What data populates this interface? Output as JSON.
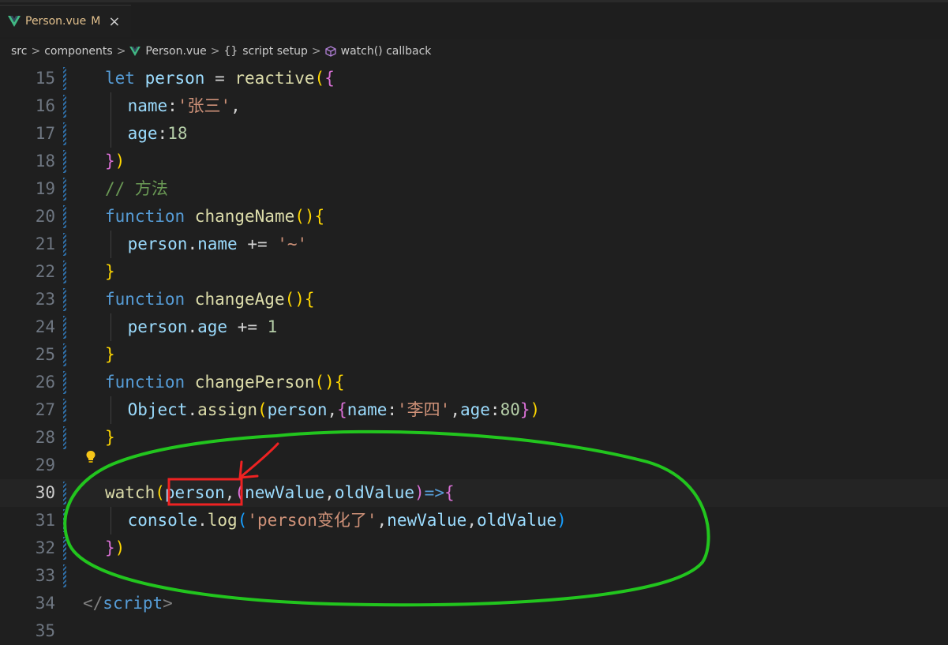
{
  "tab": {
    "name": "Person.vue",
    "status": "M",
    "close": "×"
  },
  "breadcrumb": {
    "parts": [
      "src",
      "components",
      "Person.vue",
      "script setup",
      "watch() callback"
    ],
    "braces": "{}",
    "sep": ">"
  },
  "colors": {
    "vue_green": "#41b883",
    "vue_dark": "#35495e",
    "annotation_green": "#22c51e",
    "annotation_red": "#ee2222",
    "keyword": "#569cd6",
    "function": "#dcdcaa",
    "variable": "#9cdcfe",
    "string": "#ce9178",
    "number": "#b5cea8",
    "comment": "#6a9955"
  },
  "icons": [
    "vue-logo-icon",
    "braces-icon",
    "cube-icon",
    "lightbulb-icon",
    "close-icon"
  ],
  "lines": [
    {
      "n": "15",
      "tokens": [
        [
          "kw",
          "let "
        ],
        [
          "var",
          "person"
        ],
        [
          "plain",
          " = "
        ],
        [
          "fn",
          "reactive"
        ],
        [
          "b1",
          "("
        ],
        [
          "b2",
          "{"
        ]
      ]
    },
    {
      "n": "16",
      "tokens": [
        [
          "var",
          "name"
        ],
        [
          "plain",
          ":"
        ],
        [
          "str",
          "'张三'"
        ],
        [
          "plain",
          ","
        ]
      ]
    },
    {
      "n": "17",
      "tokens": [
        [
          "var",
          "age"
        ],
        [
          "plain",
          ":"
        ],
        [
          "num",
          "18"
        ]
      ]
    },
    {
      "n": "18",
      "tokens": [
        [
          "b2",
          "}"
        ],
        [
          "b1",
          ")"
        ]
      ]
    },
    {
      "n": "19",
      "tokens": [
        [
          "cm",
          "// 方法"
        ]
      ]
    },
    {
      "n": "20",
      "tokens": [
        [
          "kw",
          "function "
        ],
        [
          "fn",
          "changeName"
        ],
        [
          "b1",
          "()"
        ],
        [
          "b1",
          "{"
        ]
      ]
    },
    {
      "n": "21",
      "tokens": [
        [
          "var",
          "person"
        ],
        [
          "plain",
          "."
        ],
        [
          "var",
          "name"
        ],
        [
          "plain",
          " += "
        ],
        [
          "str",
          "'~'"
        ]
      ]
    },
    {
      "n": "22",
      "tokens": [
        [
          "b1",
          "}"
        ]
      ]
    },
    {
      "n": "23",
      "tokens": [
        [
          "kw",
          "function "
        ],
        [
          "fn",
          "changeAge"
        ],
        [
          "b1",
          "()"
        ],
        [
          "b1",
          "{"
        ]
      ]
    },
    {
      "n": "24",
      "tokens": [
        [
          "var",
          "person"
        ],
        [
          "plain",
          "."
        ],
        [
          "var",
          "age"
        ],
        [
          "plain",
          " += "
        ],
        [
          "num",
          "1"
        ]
      ]
    },
    {
      "n": "25",
      "tokens": [
        [
          "b1",
          "}"
        ]
      ]
    },
    {
      "n": "26",
      "tokens": [
        [
          "kw",
          "function "
        ],
        [
          "fn",
          "changePerson"
        ],
        [
          "b1",
          "()"
        ],
        [
          "b1",
          "{"
        ]
      ]
    },
    {
      "n": "27",
      "tokens": [
        [
          "var",
          "Object"
        ],
        [
          "plain",
          "."
        ],
        [
          "fn",
          "assign"
        ],
        [
          "b1",
          "("
        ],
        [
          "var",
          "person"
        ],
        [
          "plain",
          ","
        ],
        [
          "b2",
          "{"
        ],
        [
          "var",
          "name"
        ],
        [
          "plain",
          ":"
        ],
        [
          "str",
          "'李四'"
        ],
        [
          "plain",
          ","
        ],
        [
          "var",
          "age"
        ],
        [
          "plain",
          ":"
        ],
        [
          "num",
          "80"
        ],
        [
          "b2",
          "}"
        ],
        [
          "b1",
          ")"
        ]
      ]
    },
    {
      "n": "28",
      "tokens": [
        [
          "b1",
          "}"
        ]
      ]
    },
    {
      "n": "29",
      "tokens": []
    },
    {
      "n": "30",
      "tokens": [
        [
          "fn",
          "watch"
        ],
        [
          "b1",
          "("
        ],
        [
          "var",
          "person"
        ],
        [
          "plain",
          ","
        ],
        [
          "b2",
          "("
        ],
        [
          "var",
          "newValue"
        ],
        [
          "plain",
          ","
        ],
        [
          "var",
          "oldValue"
        ],
        [
          "b2",
          ")"
        ],
        [
          "kw",
          "=>"
        ],
        [
          "b2",
          "{"
        ]
      ]
    },
    {
      "n": "31",
      "tokens": [
        [
          "var",
          "console"
        ],
        [
          "plain",
          "."
        ],
        [
          "fn",
          "log"
        ],
        [
          "b3",
          "("
        ],
        [
          "str",
          "'person变化了'"
        ],
        [
          "plain",
          ","
        ],
        [
          "var",
          "newValue"
        ],
        [
          "plain",
          ","
        ],
        [
          "var",
          "oldValue"
        ],
        [
          "b3",
          ")"
        ]
      ]
    },
    {
      "n": "32",
      "tokens": [
        [
          "b2",
          "}"
        ],
        [
          "b1",
          ")"
        ]
      ]
    },
    {
      "n": "33",
      "tokens": []
    },
    {
      "n": "34",
      "tokens": [
        [
          "tag",
          "</"
        ],
        [
          "tagn",
          "script"
        ],
        [
          "tag",
          ">"
        ]
      ]
    },
    {
      "n": "35",
      "tokens": []
    }
  ]
}
